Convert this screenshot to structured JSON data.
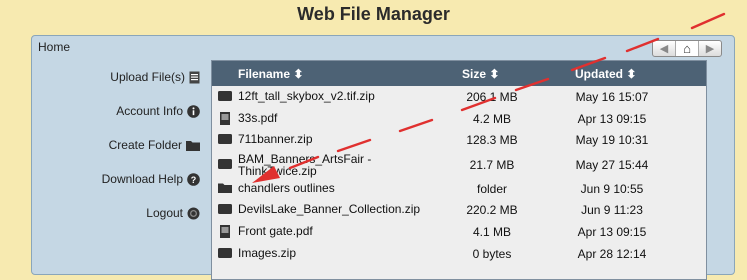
{
  "app": {
    "title": "Web File Manager"
  },
  "breadcrumb": {
    "text": "Home"
  },
  "nav": {
    "back": "◀",
    "home": "⌂",
    "forward": "▶"
  },
  "sidebar": {
    "items": [
      {
        "label": "Upload File(s)",
        "icon": "document-icon"
      },
      {
        "label": "Account Info",
        "icon": "info-icon"
      },
      {
        "label": "Create Folder",
        "icon": "folder-icon"
      },
      {
        "label": "Download Help",
        "icon": "help-icon"
      },
      {
        "label": "Logout",
        "icon": "power-icon"
      }
    ]
  },
  "table": {
    "headers": {
      "filename": "Filename ⬍",
      "size": "Size ⬍",
      "updated": "Updated ⬍"
    },
    "rows": [
      {
        "name": "12ft_tall_skybox_v2.tif.zip",
        "size": "206.1 MB",
        "updated": "May 16 15:07",
        "type": "zip"
      },
      {
        "name": "33s.pdf",
        "size": "4.2 MB",
        "updated": "Apr 13 09:15",
        "type": "pdf"
      },
      {
        "name": "711banner.zip",
        "size": "128.3 MB",
        "updated": "May 19 10:31",
        "type": "zip"
      },
      {
        "name": "BAM_Banners_ArtsFair - ThinkTwice.zip",
        "size": "21.7 MB",
        "updated": "May 27 15:44",
        "type": "zip"
      },
      {
        "name": "chandlers outlines",
        "size": "folder",
        "updated": "Jun 9 10:55",
        "type": "folder"
      },
      {
        "name": "DevilsLake_Banner_Collection.zip",
        "size": "220.2 MB",
        "updated": "Jun 9 11:23",
        "type": "zip"
      },
      {
        "name": "Front gate.pdf",
        "size": "4.1 MB",
        "updated": "Apr 13 09:15",
        "type": "pdf"
      },
      {
        "name": "Images.zip",
        "size": "0 bytes",
        "updated": "Apr 28 12:14",
        "type": "zip"
      }
    ]
  },
  "colors": {
    "background": "#f7eab0",
    "panel": "#c5d7e4",
    "header": "#4d6275",
    "annotation": "#e0302f"
  }
}
